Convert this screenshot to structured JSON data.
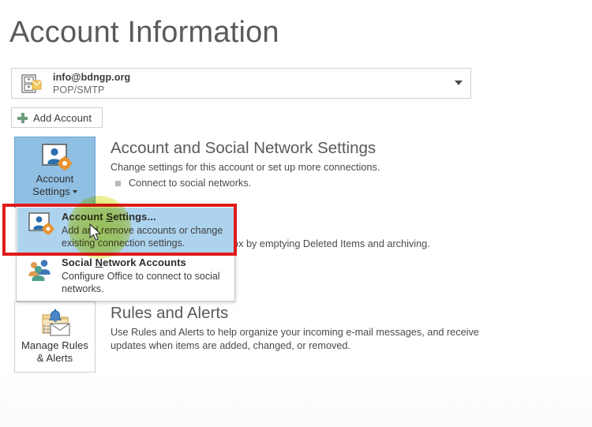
{
  "page": {
    "title": "Account Information"
  },
  "account_selector": {
    "email": "info@bdngp.org",
    "account_type": "POP/SMTP",
    "icon": "mail-account-icon",
    "chevron_icon": "chevron-down-icon"
  },
  "add_account": {
    "label": "Add Account",
    "icon": "plus-icon"
  },
  "tiles": [
    {
      "id": "account-settings",
      "label_line1": "Account",
      "label_line2": "Settings",
      "icon": "person-gear-icon",
      "has_caret": true,
      "state": "selected"
    },
    {
      "id": "manage-rules",
      "label_line1": "Manage Rules",
      "label_line2": "& Alerts",
      "icon": "rules-alerts-icon",
      "has_caret": false,
      "state": "normal"
    }
  ],
  "sections": [
    {
      "id": "account-social",
      "title": "Account and Social Network Settings",
      "desc": "Change settings for this account or set up more connections.",
      "bullet": "Connect to social networks."
    },
    {
      "id": "mailbox-cleanup",
      "title": "",
      "desc": "box by emptying Deleted Items and archiving.",
      "bullet": ""
    },
    {
      "id": "rules-alerts",
      "title": "Rules and Alerts",
      "desc": "Use Rules and Alerts to help organize your incoming e-mail messages, and receive updates when items are added, changed, or removed.",
      "bullet": ""
    }
  ],
  "dropdown": {
    "items": [
      {
        "id": "account-settings",
        "title_before": "Account ",
        "title_accesskey": "S",
        "title_after": "ettings...",
        "desc": "Add and remove accounts or change existing connection settings.",
        "icon": "person-gear-icon",
        "highlighted": true
      },
      {
        "id": "social-network-accounts",
        "title_before": "Social ",
        "title_accesskey": "N",
        "title_after": "etwork Accounts",
        "desc": "Configure Office to connect to social networks.",
        "icon": "social-people-icon",
        "highlighted": false
      }
    ]
  },
  "annotations": {
    "red_box_target": "account-settings-menu-item",
    "red_box_color": "#e01b1b",
    "cursor_highlight_color": "#d5de25"
  },
  "colors": {
    "selected_tile": "#8fbfe3",
    "menu_highlight": "#aed3ef",
    "accent_green": "#6c9c7e",
    "title_gray": "#5a5a5a"
  }
}
